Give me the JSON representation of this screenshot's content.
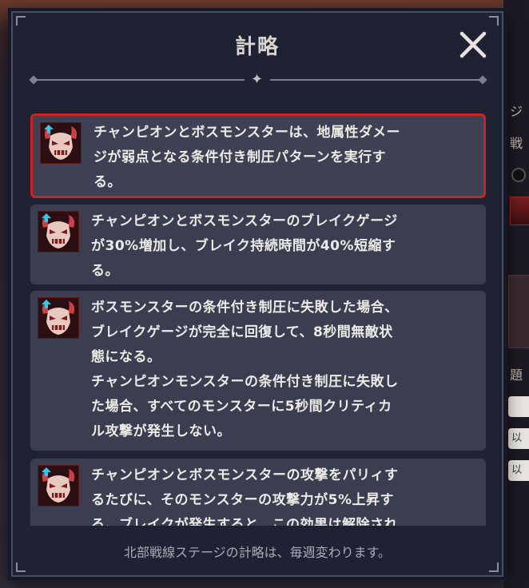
{
  "dialog": {
    "title": "計略",
    "footer": "北部戦線ステージの計略は、毎週変わります。"
  },
  "strategies": [
    {
      "text": "チャンピオンとボスモンスターは、地属性ダメー\nジが弱点となる条件付き制圧パターンを実行す\nる。",
      "icon": "demon-mask-buff-icon"
    },
    {
      "text": "チャンピオンとボスモンスターのブレイクゲージ\nが30%増加し、ブレイク持続時間が40%短縮す\nる。",
      "icon": "demon-mask-buff-icon"
    },
    {
      "text": "ボスモンスターの条件付き制圧に失敗した場合、\nブレイクゲージが完全に回復して、8秒間無敵状\n態になる。\nチャンピオンモンスターの条件付き制圧に失敗し\nた場合、すべてのモンスターに5秒間クリティカ\nル攻撃が発生しない。",
      "icon": "demon-mask-buff-icon"
    },
    {
      "text": "チャンピオンとボスモンスターの攻撃をパリィす\nるたびに、そのモンスターの攻撃力が5%上昇す\nる。ブレイクが発生すると、この効果は解除され",
      "icon": "demon-mask-buff-icon"
    }
  ],
  "background_fragments": {
    "right_text_1": "ジ",
    "right_text_2": "戦",
    "right_text_3": "題",
    "right_text_4": "以",
    "right_text_5": "以"
  },
  "colors": {
    "panel": "#1f2232",
    "card": "#3b3e51",
    "selected_border": "#d12222",
    "text": "#ecebe6"
  }
}
